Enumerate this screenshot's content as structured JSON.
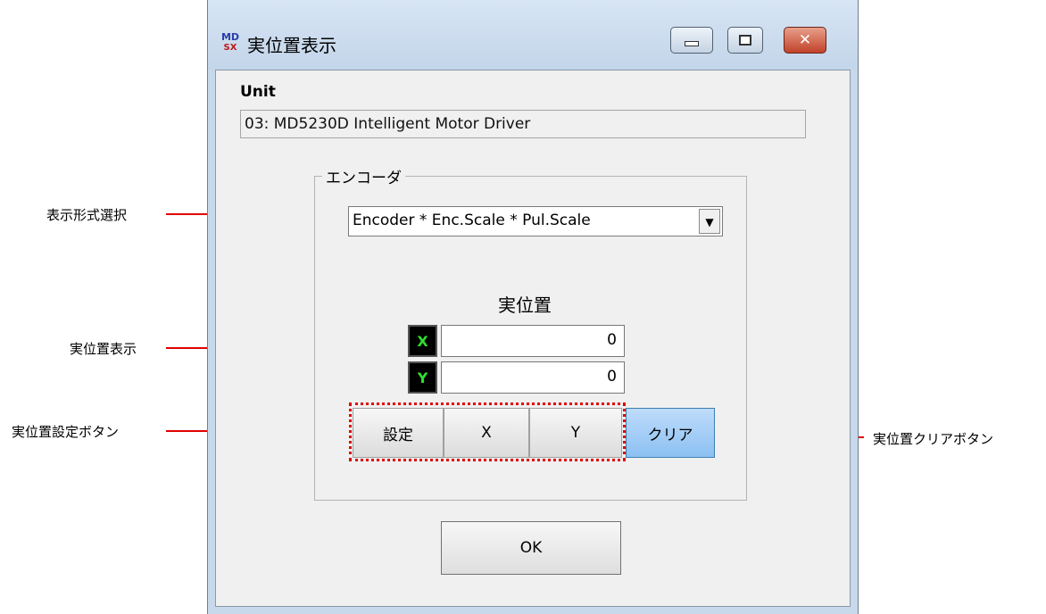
{
  "window": {
    "title": "実位置表示",
    "icon_top": "MD",
    "icon_bottom": "SX"
  },
  "unit": {
    "label": "Unit",
    "value": "03: MD5230D Intelligent Motor Driver"
  },
  "encoder_group": {
    "label": "エンコーダ",
    "display_format": "Encoder * Enc.Scale * Pul.Scale",
    "position_title": "実位置",
    "x_axis_label": "X",
    "x_value": "0",
    "y_axis_label": "Y",
    "y_value": "0"
  },
  "buttons": {
    "set": "設定",
    "x": "X",
    "y": "Y",
    "clear": "クリア",
    "ok": "OK"
  },
  "annotations": {
    "format_select": "表示形式選択",
    "position_display": "実位置表示",
    "set_buttons": "実位置設定ボタン",
    "clear_button": "実位置クリアボタン"
  },
  "colors": {
    "annotation_arrow": "#e00000",
    "axis_label_text": "#2de02d",
    "clear_button": "#8cc0f2"
  }
}
